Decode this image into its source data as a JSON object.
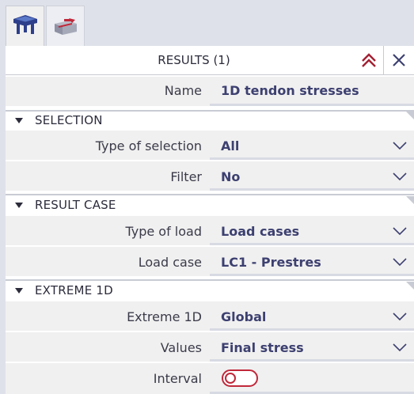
{
  "tabs": [
    {
      "icon": "results-structure-icon"
    },
    {
      "icon": "tendon-icon"
    }
  ],
  "header": {
    "title": "RESULTS (1)",
    "collapse_icon": "double-chevron-up-icon",
    "close_icon": "close-icon"
  },
  "name_row": {
    "label": "Name",
    "value": "1D tendon stresses"
  },
  "sections": {
    "selection": {
      "title": "SELECTION"
    },
    "result_case": {
      "title": "RESULT CASE"
    },
    "extreme": {
      "title": "EXTREME 1D"
    }
  },
  "fields": {
    "type_of_selection": {
      "label": "Type of selection",
      "value": "All"
    },
    "filter": {
      "label": "Filter",
      "value": "No"
    },
    "type_of_load": {
      "label": "Type of load",
      "value": "Load cases"
    },
    "load_case": {
      "label": "Load case",
      "value": "LC1 - Prestres"
    },
    "extreme_1d": {
      "label": "Extreme 1D",
      "value": "Global"
    },
    "values": {
      "label": "Values",
      "value": "Final stress"
    },
    "interval": {
      "label": "Interval",
      "on": false
    }
  },
  "colors": {
    "accent": "#3d4070",
    "toggle": "#c0283a",
    "collapse": "#a32032"
  }
}
